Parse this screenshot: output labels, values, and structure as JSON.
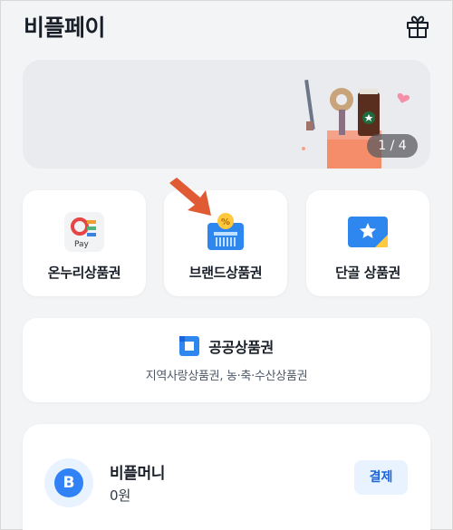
{
  "header": {
    "title": "비플페이",
    "gift_icon": "gift-icon"
  },
  "banner": {
    "page_indicator": "1 / 4"
  },
  "vouchers": [
    {
      "label": "온누리상품권",
      "icon": "onnuri-pay-icon",
      "icon_text": "Pay"
    },
    {
      "label": "브랜드상품권",
      "icon": "brand-voucher-icon",
      "icon_text": "%"
    },
    {
      "label": "단골 상품권",
      "icon": "star-voucher-icon"
    }
  ],
  "public_voucher": {
    "title": "공공상품권",
    "subtitle": "지역사랑상품권, 농·축·수산상품권",
    "icon": "public-voucher-icon"
  },
  "bpay_money": {
    "avatar_letter": "B",
    "name": "비플머니",
    "balance": "0원",
    "pay_label": "결제"
  },
  "colors": {
    "background": "#f2f4f6",
    "accent_blue": "#3182f6",
    "arrow_orange": "#e05a33"
  }
}
